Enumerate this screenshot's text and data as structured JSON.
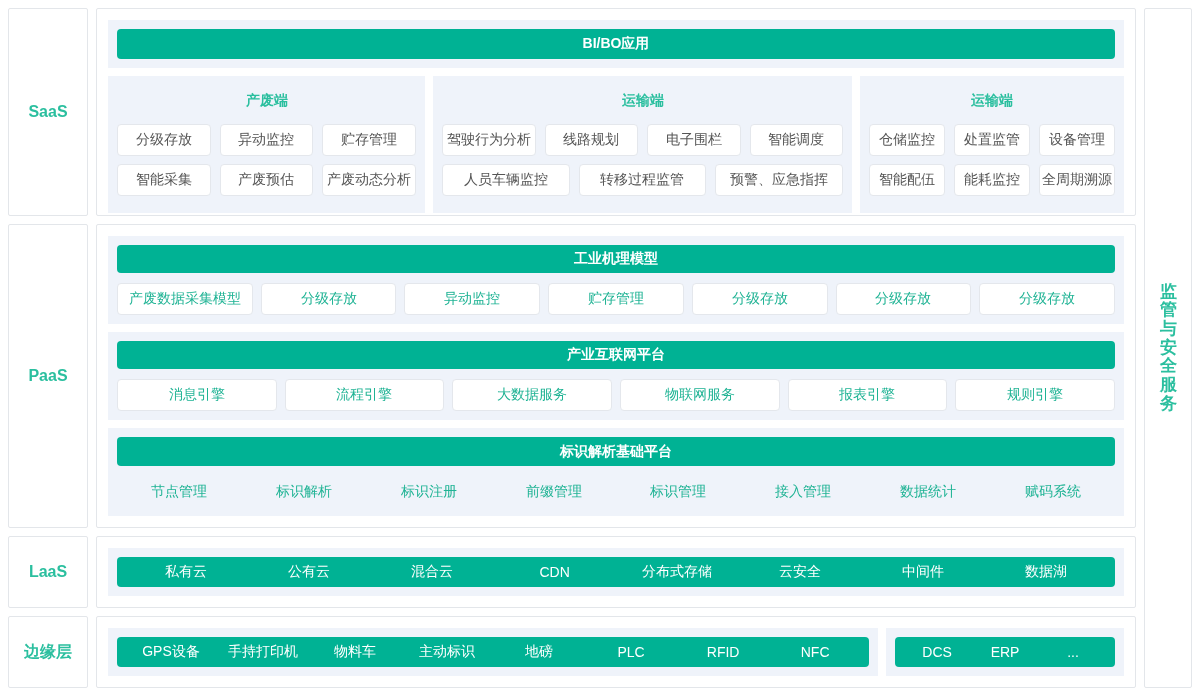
{
  "side_service": "监管与安全服务",
  "layers": [
    {
      "kind": "saas",
      "label": "SaaS",
      "banner": "BI/BO应用",
      "groups": [
        {
          "title": "产废端",
          "lines": [
            {
              "items": [
                "分级存放",
                "异动监控",
                "贮存管理"
              ]
            },
            {
              "items": [
                "智能采集",
                "产废预估",
                "产废动态分析"
              ]
            }
          ]
        },
        {
          "title": "运输端",
          "lines": [
            {
              "items": [
                "驾驶行为分析",
                "线路规划",
                "电子围栏",
                "智能调度"
              ]
            },
            {
              "items": [
                "人员车辆监控",
                "转移过程监管",
                "预警、应急指挥"
              ]
            }
          ]
        },
        {
          "title": "运输端",
          "lines": [
            {
              "items": [
                "仓储监控",
                "处置监管",
                "设备管理"
              ]
            },
            {
              "items": [
                "智能配伍",
                "能耗监控",
                "全周期溯源"
              ]
            }
          ]
        }
      ]
    },
    {
      "kind": "paas",
      "label": "PaaS",
      "sections": [
        {
          "kind": "tiles",
          "title": "工业机理模型",
          "items": [
            "产废数据采集模型",
            "分级存放",
            "异动监控",
            "贮存管理",
            "分级存放",
            "分级存放",
            "分级存放"
          ]
        },
        {
          "kind": "tiles",
          "title": "产业互联网平台",
          "items": [
            "消息引擎",
            "流程引擎",
            "大数据服务",
            "物联网服务",
            "报表引擎",
            "规则引擎"
          ]
        },
        {
          "kind": "plain",
          "title": "标识解析基础平台",
          "items": [
            "节点管理",
            "标识解析",
            "标识注册",
            "前缀管理",
            "标识管理",
            "接入管理",
            "数据统计",
            "赋码系统"
          ]
        }
      ]
    },
    {
      "kind": "strips",
      "label": "LaaS",
      "strips": [
        {
          "items": [
            "私有云",
            "公有云",
            "混合云",
            "CDN",
            "分布式存储",
            "云安全",
            "中间件",
            "数据湖"
          ]
        }
      ]
    },
    {
      "kind": "strips",
      "label": "边缘层",
      "strips": [
        {
          "items": [
            "GPS设备",
            "手持打印机",
            "物料车",
            "主动标识",
            "地磅",
            "PLC",
            "RFID",
            "NFC"
          ]
        },
        {
          "items": [
            "DCS",
            "ERP",
            "..."
          ]
        }
      ]
    }
  ]
}
